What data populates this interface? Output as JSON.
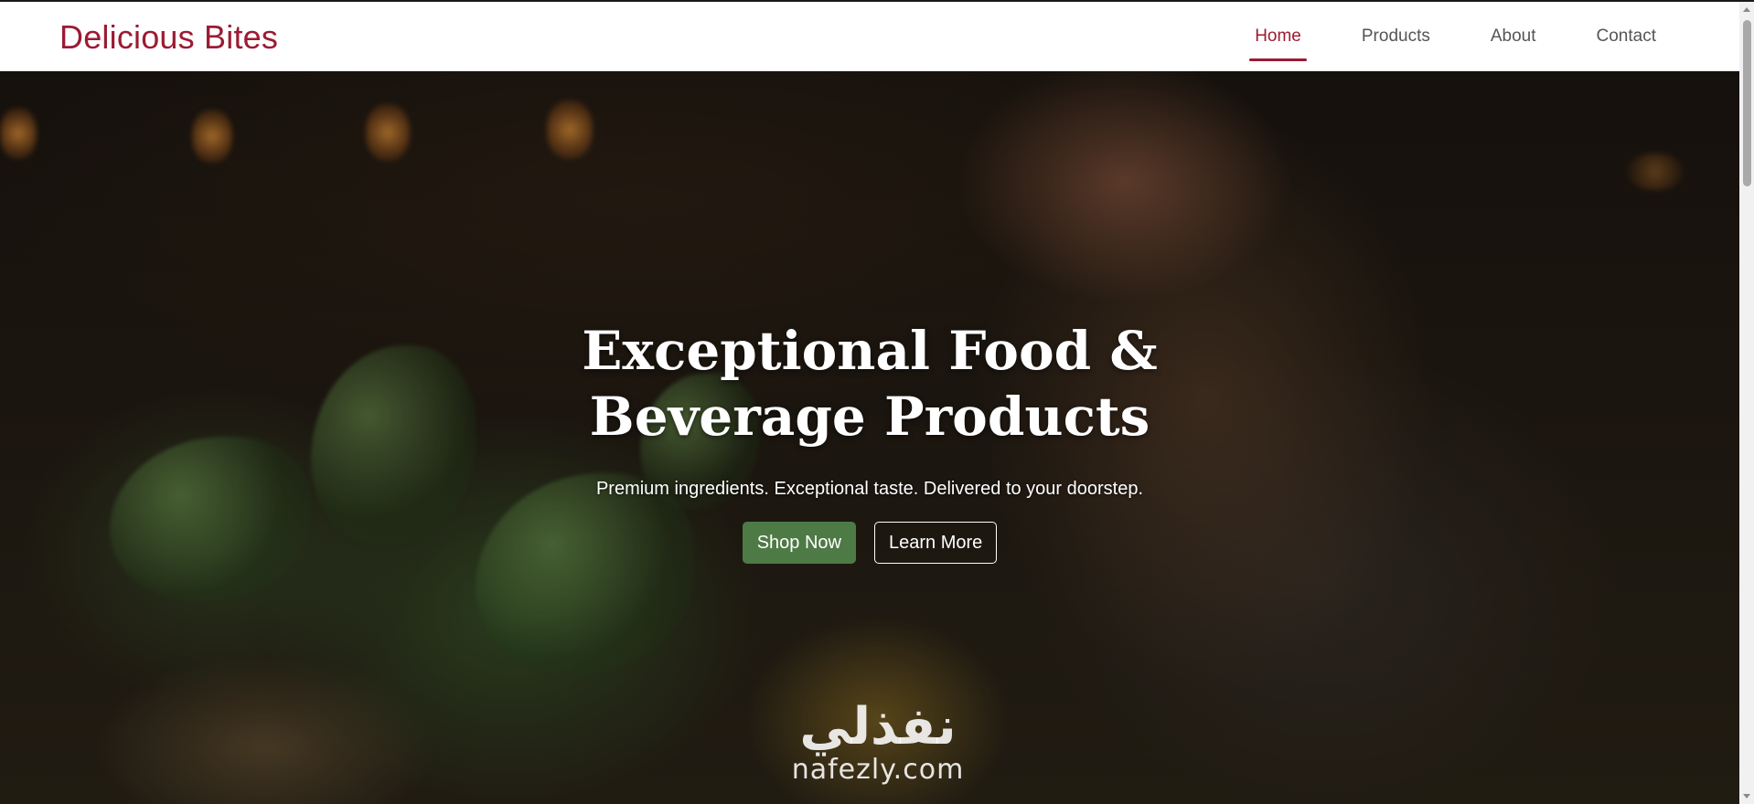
{
  "brand": {
    "name": "Delicious Bites"
  },
  "nav": {
    "items": [
      {
        "label": "Home",
        "active": true
      },
      {
        "label": "Products",
        "active": false
      },
      {
        "label": "About",
        "active": false
      },
      {
        "label": "Contact",
        "active": false
      }
    ]
  },
  "hero": {
    "title_line1": "Exceptional Food &",
    "title_line2": "Beverage Products",
    "subtitle": "Premium ingredients. Exceptional taste. Delivered to your doorstep.",
    "primary_button": "Shop Now",
    "secondary_button": "Learn More"
  },
  "watermark": {
    "arabic": "نفذلي",
    "latin": "nafezly.com"
  },
  "colors": {
    "brand": "#9b1b33",
    "primary_button": "#4e7a45",
    "nav_text": "#555555"
  }
}
